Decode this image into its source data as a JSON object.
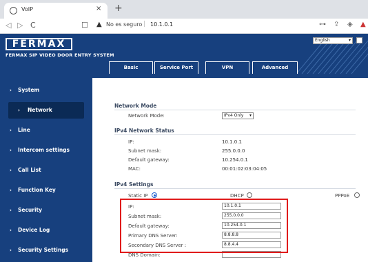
{
  "browser": {
    "tab_title": "VoIP",
    "tab_close": "×",
    "new_tab": "+",
    "back": "◁",
    "forward": "▷",
    "reload": "C",
    "bookmark": "☐",
    "security_warning": "▲",
    "security_label": "No es seguro",
    "url": "10.1.0.1",
    "icons": [
      "key-icon",
      "share-icon",
      "shield-icon",
      "extension-icon"
    ]
  },
  "header": {
    "logo": "FERMAX",
    "subtitle": "FERMAX SIP VIDEO DOOR ENTRY SYSTEM",
    "language": "English",
    "lang_arrow": "▾"
  },
  "tabs": [
    {
      "label": "Basic"
    },
    {
      "label": "Service Port"
    },
    {
      "label": "VPN"
    },
    {
      "label": "Advanced"
    }
  ],
  "sidebar": {
    "chevron": "›",
    "items": [
      {
        "label": "System"
      },
      {
        "label": "Network"
      },
      {
        "label": "Line"
      },
      {
        "label": "Intercom settings"
      },
      {
        "label": "Call List"
      },
      {
        "label": "Function Key"
      },
      {
        "label": "Security"
      },
      {
        "label": "Device Log"
      },
      {
        "label": "Security Settings"
      }
    ]
  },
  "network_mode": {
    "title": "Network Mode",
    "label": "Network Mode:",
    "value": "IPv4 Only",
    "arrow": "▾"
  },
  "ipv4_status": {
    "title": "IPv4 Network Status",
    "rows": [
      {
        "label": "IP:",
        "value": "10.1.0.1"
      },
      {
        "label": "Subnet mask:",
        "value": "255.0.0.0"
      },
      {
        "label": "Default gateway:",
        "value": "10.254.0.1"
      },
      {
        "label": "MAC:",
        "value": "00:01:02:03:04:05"
      }
    ]
  },
  "ipv4_settings": {
    "title": "IPv4 Settings",
    "static_ip_label": "Static IP",
    "dhcp_label": "DHCP",
    "pppoe_label": "PPPoE",
    "selected_mode": "Static IP",
    "fields": [
      {
        "label": "IP:",
        "value": "10.1.0.1"
      },
      {
        "label": "Subnet mask:",
        "value": "255.0.0.0"
      },
      {
        "label": "Default gateway:",
        "value": "10.254.0.1"
      },
      {
        "label": "Primary DNS Server:",
        "value": "8.8.8.8"
      },
      {
        "label": "Secondary DNS Server :",
        "value": "8.8.4.4"
      },
      {
        "label": "DNS Domain:",
        "value": ""
      }
    ]
  },
  "colors": {
    "brand_blue": "#17407e",
    "highlight_red": "#e01b1b"
  }
}
